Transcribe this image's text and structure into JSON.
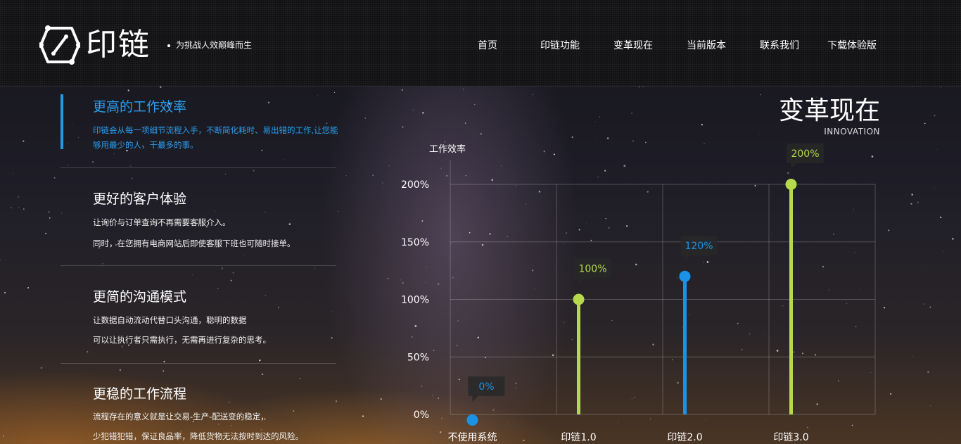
{
  "header": {
    "logo_text": "印链",
    "slogan": "为挑战人效巅峰而生",
    "nav": [
      "首页",
      "印链功能",
      "变革现在",
      "当前版本",
      "联系我们",
      "下载体验版"
    ]
  },
  "features": [
    {
      "title": "更高的工作效率",
      "desc": "印链会从每一项细节流程入手，不断简化耗时、易出错的工作,让您能够用最少的人，干最多的事。",
      "active": true
    },
    {
      "title": "更好的客户体验",
      "lines": [
        "让询价与订单查询不再需要客服介入。",
        "同时，在您拥有电商网站后即使客服下班也可随时接单。"
      ]
    },
    {
      "title": "更简的沟通模式",
      "lines": [
        "让数据自动流动代替口头沟通，聪明的数据",
        "可以让执行者只需执行，无需再进行复杂的思考。"
      ]
    },
    {
      "title": "更稳的工作流程",
      "lines": [
        "流程存在的意义就是让交易-生产-配送变的稳定，",
        "少犯错犯错，保证良品率，降低货物无法按时到达的风险。"
      ]
    }
  ],
  "section": {
    "title_cn": "变革现在",
    "title_en": "INNOVATION"
  },
  "colors": {
    "blue": "#1a93e6",
    "green": "#b5d94a",
    "accent": "#2a9ff0"
  },
  "chart_data": {
    "type": "scatter",
    "ylabel": "工作效率",
    "categories": [
      "不使用系统",
      "印链1.0",
      "印链2.0",
      "印链3.0"
    ],
    "values": [
      0,
      100,
      120,
      200
    ],
    "value_labels": [
      "0%",
      "100%",
      "120%",
      "200%"
    ],
    "point_colors": [
      "#1a93e6",
      "#b5d94a",
      "#1a93e6",
      "#b5d94a"
    ],
    "yticks": [
      "0%",
      "50%",
      "100%",
      "150%",
      "200%"
    ],
    "ylim": [
      0,
      200
    ],
    "grid": true
  }
}
